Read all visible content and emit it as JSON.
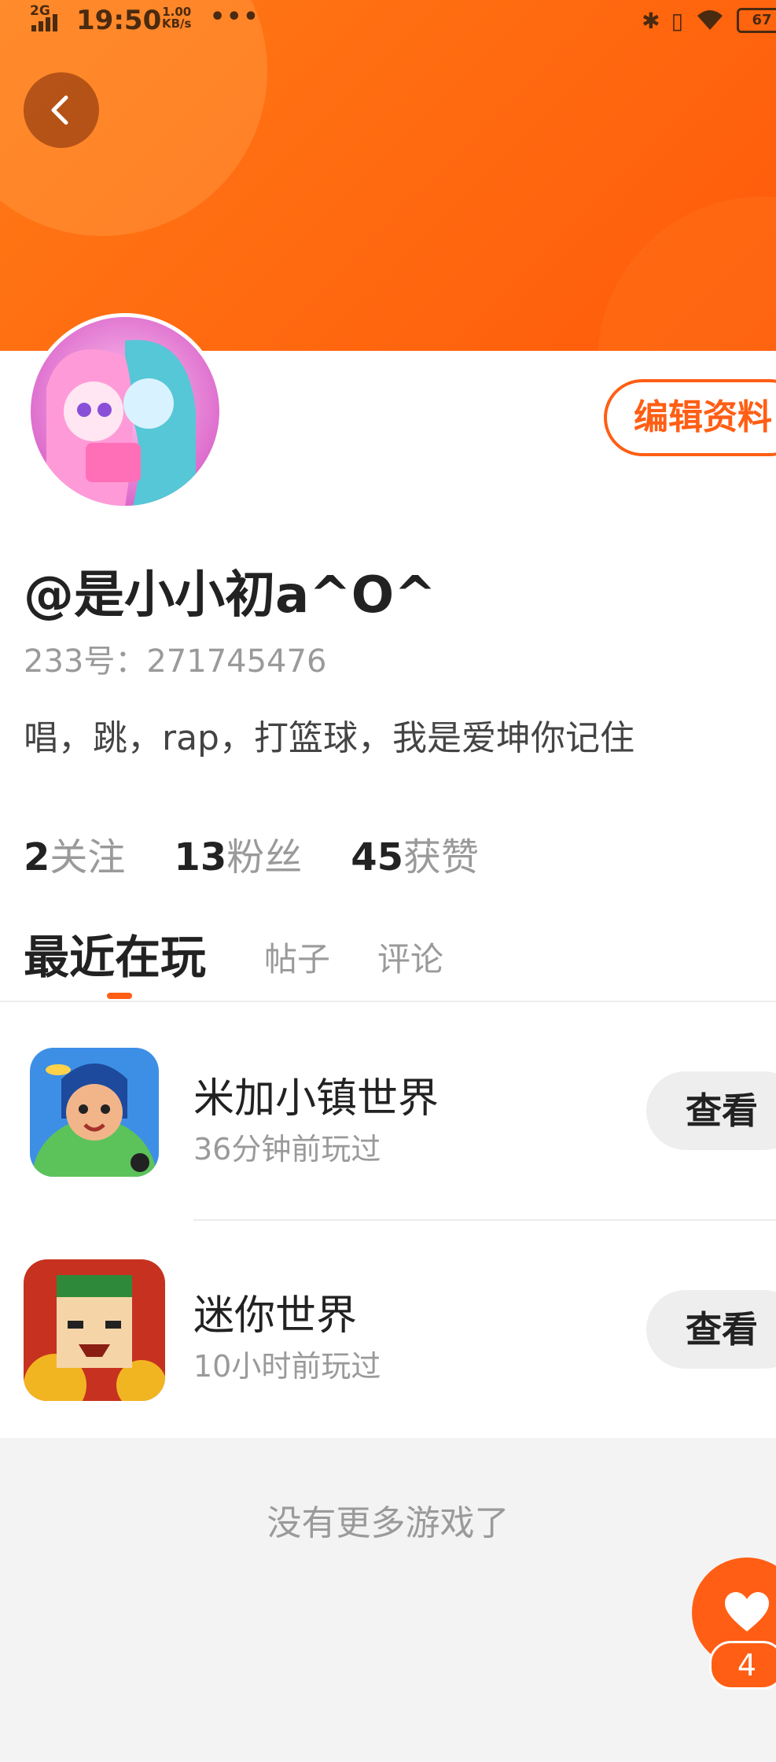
{
  "status_bar": {
    "network": "2G",
    "time": "19:50",
    "speed_value": "1.00",
    "speed_unit": "KB/s",
    "more": "•••",
    "battery": "67"
  },
  "profile": {
    "username": "@是小小初a^O^",
    "id_label": "233号：271745476",
    "bio": "唱，跳，rap，打篮球，我是爱坤你记住",
    "edit_label": "编辑资料"
  },
  "stats": [
    {
      "value": "2",
      "label": "关注"
    },
    {
      "value": "13",
      "label": "粉丝"
    },
    {
      "value": "45",
      "label": "获赞"
    }
  ],
  "tabs": [
    "最近在玩",
    "帖子",
    "评论"
  ],
  "games": [
    {
      "name": "米加小镇世界",
      "time": "36分钟前玩过",
      "action": "查看",
      "icon": "toca-world-app-icon"
    },
    {
      "name": "迷你世界",
      "time": "10小时前玩过",
      "action": "查看",
      "icon": "mini-world-app-icon"
    }
  ],
  "empty_message": "没有更多游戏了",
  "fab": {
    "badge": "4",
    "icon": "heart-icon"
  },
  "colors": {
    "accent": "#ff5e14",
    "header": "#ff7a16"
  }
}
